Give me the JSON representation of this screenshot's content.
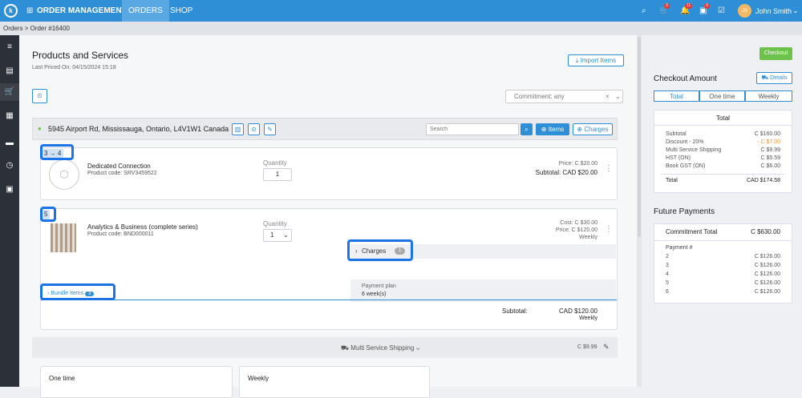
{
  "topbar": {
    "logo": "k",
    "title": "ORDER MANAGEMENT",
    "nav": [
      "ORDERS",
      "SHOP"
    ],
    "badges": [
      "3",
      "11",
      "3"
    ],
    "user": "John Smith",
    "avatar": "JS"
  },
  "breadcrumb": {
    "root": "Orders",
    "current": "Order #16400"
  },
  "header": {
    "title": "Products and Services",
    "last_priced_label": "Last Priced On:",
    "last_priced": "04/15/2024 15:18",
    "import_btn": "Import Items",
    "commitment": "Commitment: any"
  },
  "location": {
    "address": "5945 Airport Rd, Mississauga, Ontario, L4V1W1 Canada",
    "search_placeholder": "Search",
    "items_btn": "Items",
    "charges_btn": "Charges"
  },
  "item1": {
    "tag": "3 → 4",
    "name": "Dedicated Connection",
    "code_label": "Product code:",
    "code": "SRV3459522",
    "qty_label": "Quantity",
    "qty": "1",
    "price": "Price:  C $20.00",
    "subtotal": "Subtotal:  CAD $20.00"
  },
  "item2": {
    "tag": "5",
    "name": "Analytics & Business (complete series)",
    "code_label": "Product code:",
    "code": "BND000011",
    "qty_label": "Quantity",
    "qty": "1",
    "cost": "Cost:  C $30.00",
    "price": "Price:  C $120.00",
    "freq": "Weekly",
    "charges_label": "Charges",
    "charges_count": "1",
    "plan_label": "Payment plan",
    "plan_value": "6 week(s)",
    "bundle_label": "Bundle Items",
    "bundle_count": "3",
    "subtotal_label": "Subtotal:",
    "subtotal": "CAD $120.00",
    "subtotal_freq": "Weekly"
  },
  "shipping": {
    "label": "Multi Service Shipping",
    "amount": "C $9.99"
  },
  "bottom": {
    "col1": "One time",
    "col2": "Weekly"
  },
  "checkout": {
    "button": "Checkout",
    "title": "Checkout Amount",
    "details": "Details",
    "tabs": [
      "Total",
      "One time",
      "Weekly"
    ],
    "box_title": "Total",
    "rows": [
      [
        "Subtotal",
        "C $160.00"
      ],
      [
        "Discount - 20%",
        "- C $7.00"
      ],
      [
        "Multi Service Shipping",
        "C $9.99"
      ],
      [
        "HST (ON)",
        "C $5.59"
      ],
      [
        "Book GST (ON)",
        "C $6.00"
      ]
    ],
    "total_label": "Total",
    "total_value": "CAD $174.58"
  },
  "future": {
    "title": "Future Payments",
    "commit_label": "Commitment Total",
    "commit_value": "C $630.00",
    "payment_header": "Payment #",
    "payments": [
      [
        "2",
        "C $126.00"
      ],
      [
        "3",
        "C $126.00"
      ],
      [
        "4",
        "C $126.00"
      ],
      [
        "5",
        "C $126.00"
      ],
      [
        "6",
        "C $126.00"
      ]
    ]
  },
  "colors": {
    "primary": "#2e8fd6",
    "checkout": "#6cc24a",
    "discount": "#f0932b",
    "highlight": "#1a73e8"
  }
}
